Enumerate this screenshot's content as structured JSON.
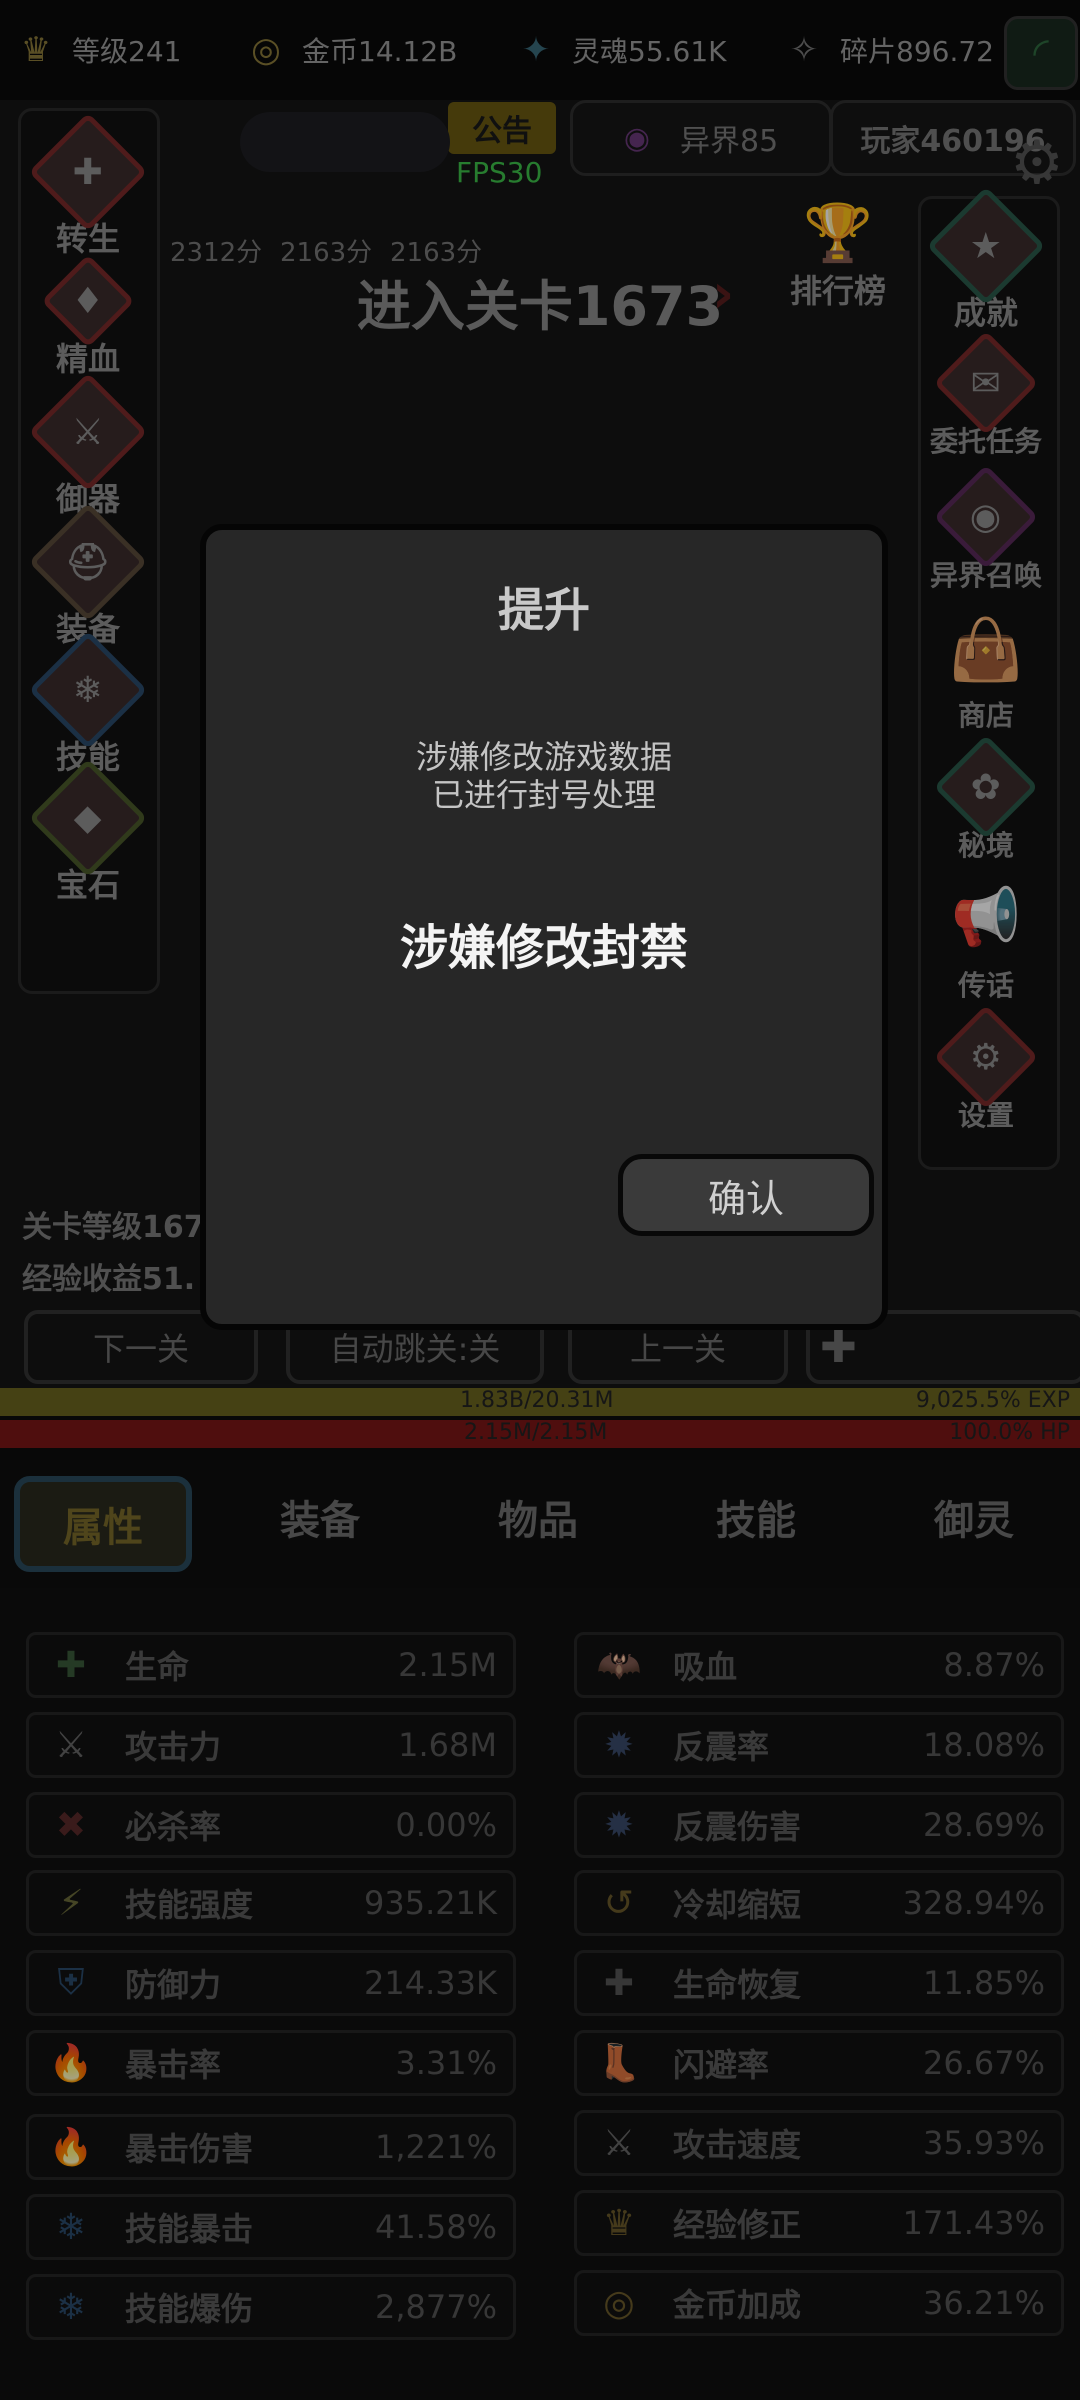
{
  "topbar": {
    "level": "等级241",
    "gold": "金币14.12B",
    "soul": "灵魂55.61K",
    "shard": "碎片896.72",
    "icons": [
      "crown-icon",
      "coin-icon",
      "soul-icon",
      "shard-icon",
      "wifi-icon"
    ]
  },
  "header": {
    "notice": "公告",
    "fps": "FPS30",
    "otherworld": "异界85",
    "player": "玩家460196",
    "stage": "进入关卡1673",
    "scores": [
      "2312分",
      "2163分",
      "2163分"
    ]
  },
  "left_menu": [
    "转生",
    "精血",
    "御器",
    "装备",
    "技能",
    "宝石"
  ],
  "right_menu": [
    "排行榜",
    "成就",
    "委托任务",
    "异界召唤",
    "商店",
    "秘境",
    "传话",
    "设置"
  ],
  "info": {
    "stage_level": "关卡等级167",
    "exp_gain": "经验收益51."
  },
  "nav": {
    "next": "下一关",
    "auto": "自动跳关:关",
    "prev": "上一关"
  },
  "bars": {
    "exp_text": "1.83B/20.31M",
    "exp_pct": "9,025.5% EXP",
    "hp_text": "2.15M/2.15M",
    "hp_pct": "100.0%  HP"
  },
  "tabs": [
    "属性",
    "装备",
    "物品",
    "技能",
    "御灵"
  ],
  "stats_left": [
    {
      "name": "生命",
      "value": "2.15M"
    },
    {
      "name": "攻击力",
      "value": "1.68M"
    },
    {
      "name": "必杀率",
      "value": "0.00%"
    },
    {
      "name": "技能强度",
      "value": "935.21K"
    },
    {
      "name": "防御力",
      "value": "214.33K"
    },
    {
      "name": "暴击率",
      "value": "3.31%"
    },
    {
      "name": "暴击伤害",
      "value": "1,221%"
    },
    {
      "name": "技能暴击",
      "value": "41.58%"
    },
    {
      "name": "技能爆伤",
      "value": "2,877%"
    }
  ],
  "stats_right": [
    {
      "name": "吸血",
      "value": "8.87%"
    },
    {
      "name": "反震率",
      "value": "18.08%"
    },
    {
      "name": "反震伤害",
      "value": "28.69%"
    },
    {
      "name": "冷却缩短",
      "value": "328.94%"
    },
    {
      "name": "生命恢复",
      "value": "11.85%"
    },
    {
      "name": "闪避率",
      "value": "26.67%"
    },
    {
      "name": "攻击速度",
      "value": "35.93%"
    },
    {
      "name": "经验修正",
      "value": "171.43%"
    },
    {
      "name": "金币加成",
      "value": "36.21%"
    }
  ],
  "dialog": {
    "title": "提升",
    "line1": "涉嫌修改游戏数据",
    "line2": "已进行封号处理",
    "headline": "涉嫌修改封禁",
    "confirm": "确认"
  },
  "colors": {
    "exp_bar": "#6b6420",
    "hp_bar": "#7a1616",
    "fps": "#3cbf49"
  }
}
